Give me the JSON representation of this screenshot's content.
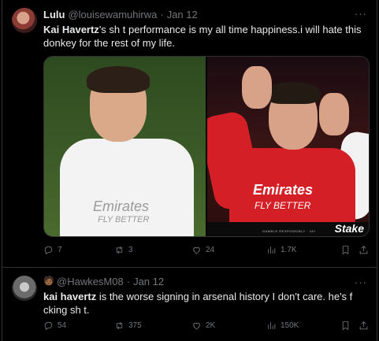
{
  "tweets": [
    {
      "name": "Lulu",
      "handle": "@louisewamuhirwa",
      "date": "Jan 12",
      "text_bold": "Kai Havertz",
      "text_rest": "'s sh t performance is my all time happiness.i will hate this donkey for the rest of my life.",
      "media": {
        "left_sponsor": "Emirates",
        "left_sponsor2": "FLY BETTER",
        "right_sponsor": "Emirates",
        "right_sponsor2": "FLY BETTER",
        "right_bar_text": "GAMBLE RESPONSIBLY · 18+",
        "right_logo": "Stake"
      },
      "stats": {
        "replies": "7",
        "retweets": "3",
        "likes": "24",
        "views": "1.7K"
      }
    },
    {
      "name": "",
      "emoji": "🧑🏾",
      "handle": "@HawkesM08",
      "date": "Jan 12",
      "text_bold": "kai havertz",
      "text_rest": " is the worse signing in arsenal history I don't care. he's f  cking sh t.",
      "stats": {
        "replies": "54",
        "retweets": "375",
        "likes": "2K",
        "views": "150K"
      }
    }
  ],
  "ui": {
    "more_glyph": "···",
    "dot": "·"
  },
  "icons": [
    "reply-icon",
    "retweet-icon",
    "like-icon",
    "views-icon",
    "bookmark-icon",
    "share-icon"
  ],
  "colors": {
    "background": "#000000",
    "text": "#e7e9ea",
    "muted": "#71767b",
    "border": "#2f3336"
  }
}
